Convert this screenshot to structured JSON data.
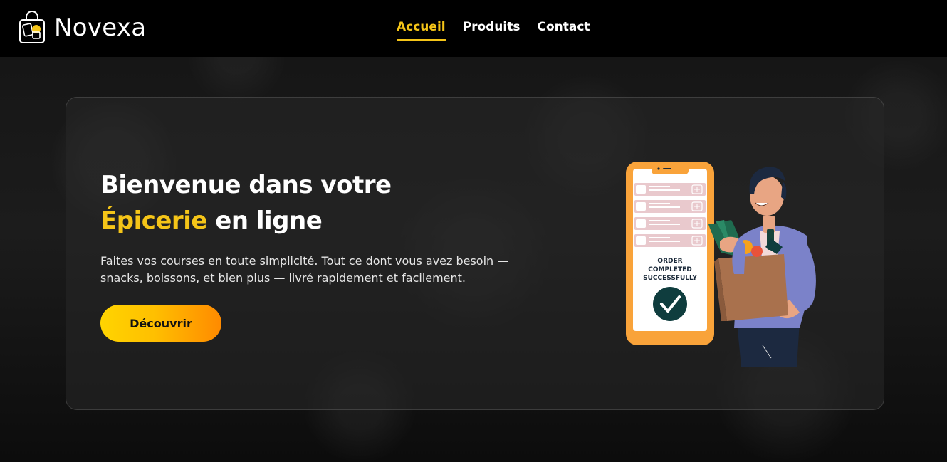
{
  "brand": {
    "name": "Novexa",
    "logo_icon": "shopping-bag-icon"
  },
  "nav": {
    "links": [
      {
        "label": "Accueil",
        "active": true
      },
      {
        "label": "Produits",
        "active": false
      },
      {
        "label": "Contact",
        "active": false
      }
    ]
  },
  "hero": {
    "title_line1": "Bienvenue dans votre",
    "title_highlight": "Épicerie",
    "title_line2_rest": " en ligne",
    "description": "Faites vos courses en toute simplicité. Tout ce dont vous avez besoin — snacks, boissons, et bien plus — livré rapidement et facilement.",
    "cta_label": "Découvrir"
  },
  "illustration": {
    "order_status_line1": "ORDER",
    "order_status_line2": "COMPLETED",
    "order_status_line3": "SUCCESSFULLY"
  },
  "colors": {
    "accent": "#f5c518",
    "navbar_bg": "#000000",
    "cta_gradient_start": "#ffd400",
    "cta_gradient_end": "#ff8a00",
    "phone_orange": "#f9a33a"
  }
}
